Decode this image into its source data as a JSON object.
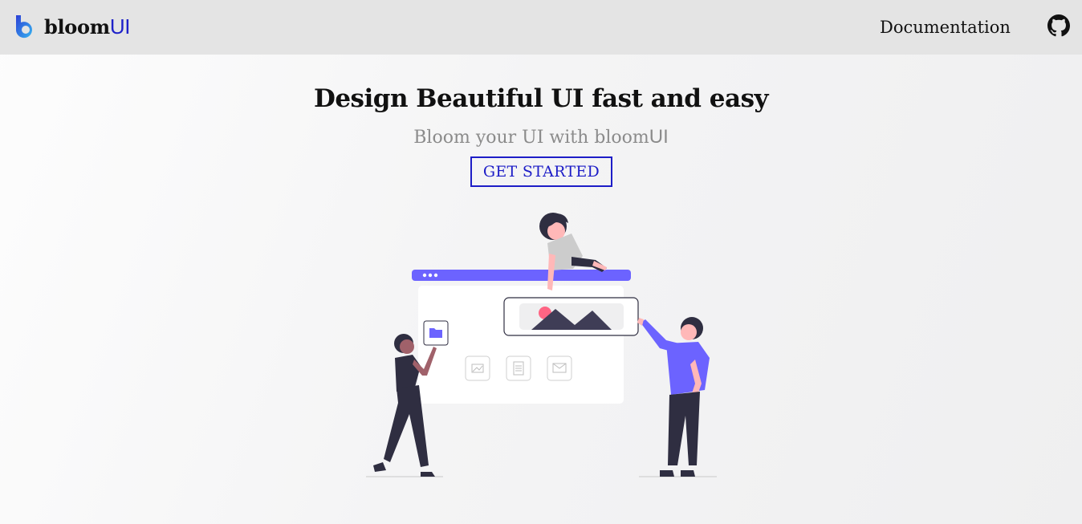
{
  "navbar": {
    "brand_bloom": "bloom",
    "brand_ui": "UI",
    "documentation_label": "Documentation",
    "github_icon": "github-icon"
  },
  "hero": {
    "title": "Design Beautiful UI fast and easy",
    "subtitle_prefix": "Bloom your UI with bloom",
    "subtitle_ui": "UI",
    "cta_label": "GET STARTED"
  },
  "illustration": {
    "name": "people-building-ui-illustration",
    "accent": "#6c63ff",
    "highlight": "#ff6584",
    "dark": "#2f2e41",
    "skin_light": "#ffb8b8",
    "skin_dark": "#a0616a"
  },
  "colors": {
    "brand_blue": "#1f22c9",
    "navbar_bg": "#e4e4e4",
    "subtitle_gray": "#8b8b8b"
  }
}
